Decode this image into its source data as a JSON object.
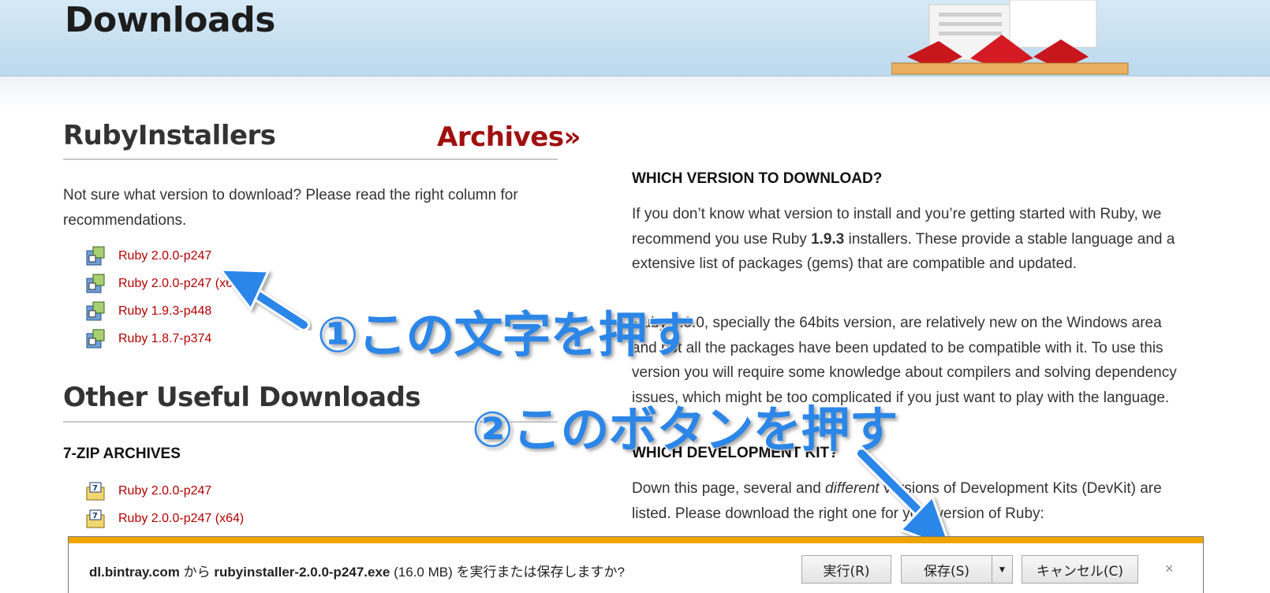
{
  "header": {
    "title": "Downloads"
  },
  "installers": {
    "title": "RubyInstallers",
    "archives_label": "Archives»",
    "intro": "Not sure what version to download? Please read the right column for recommendations.",
    "items": [
      {
        "label": "Ruby 2.0.0-p247"
      },
      {
        "label": "Ruby 2.0.0-p247 (x64)"
      },
      {
        "label": "Ruby 1.9.3-p448"
      },
      {
        "label": "Ruby 1.8.7-p374"
      }
    ]
  },
  "other": {
    "title": "Other Useful Downloads",
    "zip_heading": "7-ZIP ARCHIVES",
    "items": [
      {
        "label": "Ruby 2.0.0-p247"
      },
      {
        "label": "Ruby 2.0.0-p247 (x64)"
      }
    ]
  },
  "right": {
    "which_version": {
      "heading": "WHICH VERSION TO DOWNLOAD?",
      "p1_before": "If you don’t know what version to install and you’re getting started with Ruby, we recommend you use Ruby ",
      "p1_bold": "1.9.3",
      "p1_after": " installers. These provide a stable language and a extensive list of packages (gems) that are compatible and updated.",
      "p2": "Ruby 2.0.0, specially the 64bits version, are relatively new on the Windows area and not all the packages have been updated to be compatible with it. To use this version you will require some knowledge about compilers and solving dependency issues, which might be too complicated if you just want to play with the language."
    },
    "devkit": {
      "heading": "WHICH DEVELOPMENT KIT?",
      "p_before": "Down this page, several and ",
      "p_em": "different",
      "p_after": " versions of Development Kits (DevKit) are listed. Please download the right one for your version of Ruby:"
    }
  },
  "annotations": {
    "step1": "①この文字を押す",
    "step2": "②このボタンを押す",
    "color": "#2b86e8"
  },
  "download_bar": {
    "host": "dl.bintray.com",
    "from": " から ",
    "filename": "rubyinstaller-2.0.0-p247.exe",
    "size": " (16.0 MB) ",
    "question": "を実行または保存しますか?",
    "run_label": "実行(R)",
    "save_label": "保存(S)",
    "cancel_label": "キャンセル(C)",
    "close_label": "×",
    "accent_color": "#f0a400"
  },
  "colors": {
    "link": "#b20000",
    "header_bg": "#c8e1f2"
  }
}
